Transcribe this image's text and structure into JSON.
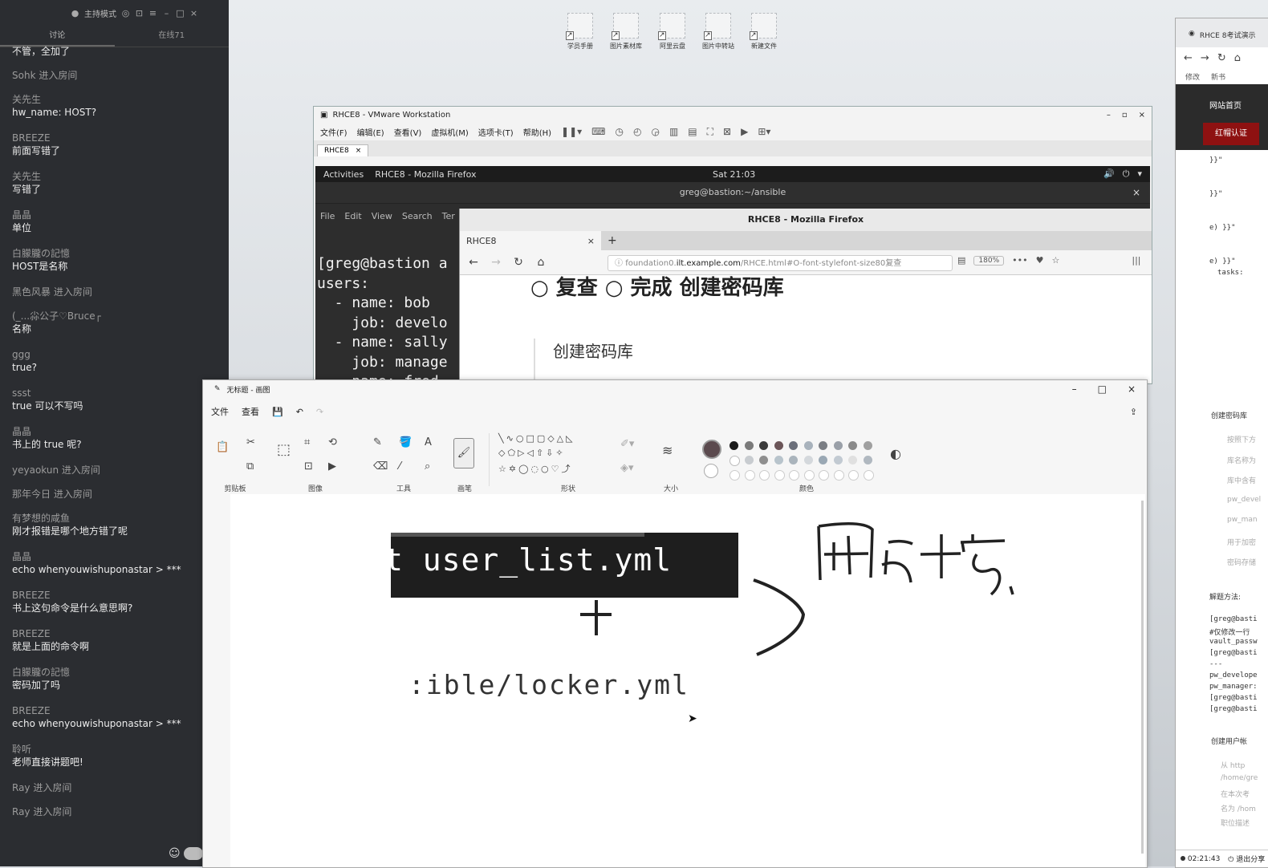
{
  "chat": {
    "topbar": {
      "mode": "主持模式"
    },
    "tabs": [
      "讨论",
      "在线71"
    ],
    "messages": [
      {
        "type": "msg",
        "user": "",
        "text": "不管，全加了"
      },
      {
        "type": "join",
        "text": "Sohk 进入房间"
      },
      {
        "type": "msg",
        "user": "关先生",
        "text": "hw_name: HOST?"
      },
      {
        "type": "msg",
        "user": "BREEZE",
        "text": "前面写错了"
      },
      {
        "type": "msg",
        "user": "关先生",
        "text": "写错了"
      },
      {
        "type": "msg",
        "user": "晶晶",
        "text": "单位"
      },
      {
        "type": "msg",
        "user": "白朦朧の記憶",
        "text": "HOST是名称"
      },
      {
        "type": "join",
        "text": "黑色风暴 进入房间"
      },
      {
        "type": "msg",
        "user": "(_...尛公子♡Bruce┌",
        "text": "名称"
      },
      {
        "type": "msg",
        "user": "ggg",
        "text": "true?"
      },
      {
        "type": "msg",
        "user": "ssst",
        "text": "true 可以不写吗"
      },
      {
        "type": "msg",
        "user": "晶晶",
        "text": "书上的 true 呢?"
      },
      {
        "type": "join",
        "text": "yeyaokun 进入房间"
      },
      {
        "type": "join",
        "text": "那年今日 进入房间"
      },
      {
        "type": "msg",
        "user": "有梦想的咸鱼",
        "text": "刚才报错是哪个地方错了呢"
      },
      {
        "type": "msg",
        "user": "晶晶",
        "text": "echo whenyouwishuponastar > ***"
      },
      {
        "type": "msg",
        "user": "BREEZE",
        "text": "书上这句命令是什么意思啊?"
      },
      {
        "type": "msg",
        "user": "BREEZE",
        "text": "就是上面的命令啊"
      },
      {
        "type": "msg",
        "user": "白朦朧の記憶",
        "text": "密码加了吗"
      },
      {
        "type": "msg",
        "user": "BREEZE",
        "text": "echo whenyouwishuponastar > ***"
      },
      {
        "type": "msg",
        "user": "聆听",
        "text": "老师直接讲题吧!"
      },
      {
        "type": "join",
        "text": "Ray 进入房间"
      },
      {
        "type": "join",
        "text": "Ray 进入房间"
      }
    ]
  },
  "desktop": {
    "icons": [
      "学员手册",
      "图片素材库",
      "阿里云盘",
      "图片中转站",
      "新建文件"
    ]
  },
  "vmware": {
    "title": "RHCE8 - VMware Workstation",
    "menu": [
      "文件(F)",
      "编辑(E)",
      "查看(V)",
      "虚拟机(M)",
      "选项卡(T)",
      "帮助(H)"
    ],
    "tab": "RHCE8",
    "gnome": {
      "activities": "Activities",
      "app": "RHCE8 - Mozilla Firefox",
      "clock": "Sat 21:03"
    },
    "terminal": {
      "title": "greg@bastion:~/ansible",
      "menu": [
        "File",
        "Edit",
        "View",
        "Search",
        "Ter"
      ],
      "lines": "[greg@bastion a\nusers:\n  - name: bob\n    job: develo\n  - name: sally\n    job: manage\n    name: fred"
    }
  },
  "firefox": {
    "title": "RHCE8 - Mozilla Firefox",
    "tab": "RHCE8",
    "url_pre": "foundation0.",
    "url_host": "ilt.example.com",
    "url_rest": "/RHCE.html#O-font-stylefont-size80复查",
    "zoom": "180%",
    "heading": "○ 复查 ○ 完成 创建密码库",
    "subheading": "创建密码库"
  },
  "paint": {
    "title": "无标题 - 画图",
    "menu": [
      "文件",
      "查看"
    ],
    "groups": [
      "剪贴板",
      "图像",
      "工具",
      "画笔",
      "形状",
      "大小",
      "颜色"
    ],
    "canvas_text1": "t user_list.yml",
    "canvas_text2": ":ible/locker.yml",
    "colors_row1": [
      "#1a1a1a",
      "#7a7a7a",
      "#3a3a3a",
      "#6b5558",
      "#6b6f7a",
      "#a8b2bc",
      "#7b7e84",
      "#9aa0a8",
      "#8a8a8a",
      "#a0a0a0"
    ],
    "colors_row2": [
      "#ffffff",
      "#c8ccd0",
      "#8f8f8f",
      "#b8c4cc",
      "#aab4bc",
      "#d4d8dc",
      "#9aa8b4",
      "#c2cad2",
      "#e0e0e0",
      "#b0b8c0"
    ],
    "active_color": "#5b4a4e"
  },
  "rbrowser": {
    "tab": "RHCE 8考试演示",
    "bookmarks": [
      "修改",
      "新书"
    ],
    "nav1": "网站首页",
    "nav2": "红帽认证",
    "code_lines": [
      "}}\"",
      "}}\"",
      "e) }}\"",
      "e) }}\"",
      "tasks:"
    ],
    "section1": "创建密码库",
    "items": [
      "按照下方",
      "库名称为",
      "库中含有",
      "pw_devel",
      "pw_man",
      "用于加密",
      "密码存储"
    ],
    "method": "解题方法:",
    "term_lines": [
      "[greg@basti",
      "#仅修改一行",
      "vault_passw",
      "[greg@basti",
      "---",
      "pw_develope",
      "pw_manager:",
      "[greg@basti",
      "[greg@basti"
    ],
    "section2": "创建用户帐",
    "items2": [
      "从 http",
      "/home/gre",
      "在本次考",
      "名为 /hom",
      "职位描述"
    ],
    "status_time": "02:21:43",
    "status_exit": "退出分享"
  }
}
